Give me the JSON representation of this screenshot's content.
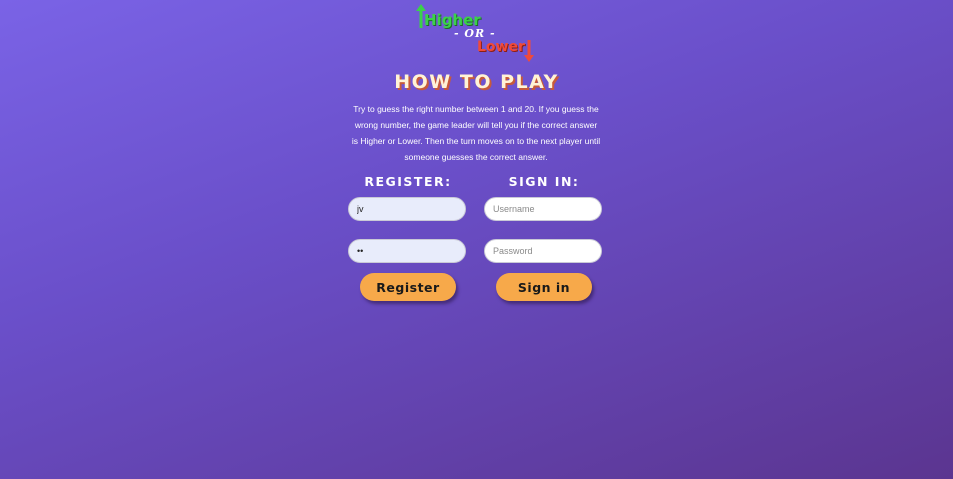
{
  "logo": {
    "higher": "Higher",
    "or": "- OR -",
    "lower": "Lower",
    "up_icon": "up-arrow-icon",
    "down_icon": "down-arrow-icon",
    "higher_color": "#3bd14a",
    "lower_color": "#f04a3a"
  },
  "title": "HOW TO PLAY",
  "description": "Try to guess the right number between 1 and 20. If you guess the wrong number, the game leader will tell you if the correct answer is Higher or Lower. Then the turn moves on to the next player until someone guesses the correct answer.",
  "register": {
    "heading": "REGISTER:",
    "username_value": "jv",
    "password_value": "••",
    "button_label": "Register"
  },
  "signin": {
    "heading": "SIGN IN:",
    "username_placeholder": "Username",
    "password_placeholder": "Password",
    "button_label": "Sign in"
  },
  "colors": {
    "accent_button": "#f7a94a",
    "background_top": "#7a63e6",
    "background_bottom": "#5b3590"
  }
}
